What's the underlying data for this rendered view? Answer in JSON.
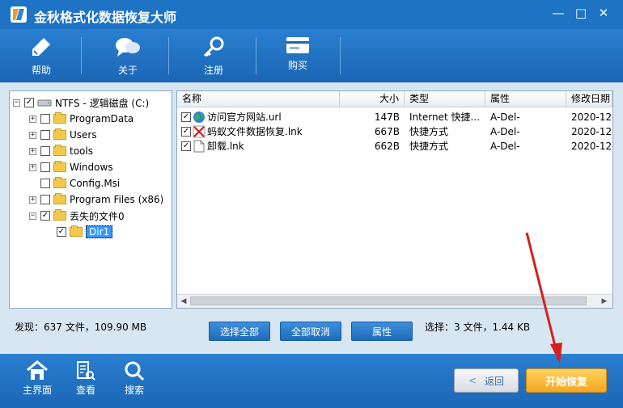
{
  "window": {
    "title": "金秋格式化数据恢复大师",
    "controls": {
      "minimize": "—",
      "maximize": "□",
      "close": "✕"
    }
  },
  "toolbar": [
    {
      "label": "帮助",
      "icon": "pen-icon"
    },
    {
      "label": "关于",
      "icon": "chat-bubble-icon"
    },
    {
      "label": "注册",
      "icon": "key-icon"
    },
    {
      "label": "购买",
      "icon": "card-icon"
    }
  ],
  "tree": {
    "root": {
      "label": "NTFS - 逻辑磁盘 (C:)",
      "checked": true,
      "expander": "−"
    },
    "items": [
      {
        "label": "ProgramData",
        "expander": "+",
        "checked": false
      },
      {
        "label": "Users",
        "expander": "+",
        "checked": false
      },
      {
        "label": "tools",
        "expander": "+",
        "checked": false
      },
      {
        "label": "Windows",
        "expander": "+",
        "checked": false
      },
      {
        "label": "Config.Msi",
        "expander": "",
        "checked": false
      },
      {
        "label": "Program Files (x86)",
        "expander": "+",
        "checked": false
      },
      {
        "label": "丢失的文件0",
        "expander": "−",
        "checked": true
      }
    ],
    "child": {
      "label": "Dir1",
      "checked": true
    }
  },
  "list": {
    "columns": [
      "名称",
      "大小",
      "类型",
      "属性",
      "修改日期"
    ],
    "rows": [
      {
        "name": "访问官方网站.url",
        "size": "147B",
        "type": "Internet 快捷...",
        "attr": "A-Del-",
        "date": "2020-12-",
        "icon": "globe-icon"
      },
      {
        "name": "蚂蚁文件数据恢复.lnk",
        "size": "667B",
        "type": "快捷方式",
        "attr": "A-Del-",
        "date": "2020-12-",
        "icon": "broken-link-icon"
      },
      {
        "name": "卸载.lnk",
        "size": "662B",
        "type": "快捷方式",
        "attr": "A-Del-",
        "date": "2020-12-",
        "icon": "file-icon"
      }
    ]
  },
  "status": {
    "found": "发现：637 文件，109.90 MB",
    "selected": "选择：3 文件，1.44 KB"
  },
  "buttons": {
    "select_all": "选择全部",
    "deselect_all": "全部取消",
    "properties": "属性"
  },
  "footer": {
    "home": "主界面",
    "view": "查看",
    "search": "搜索",
    "back": "返回",
    "restore": "开始恢复"
  },
  "colors": {
    "titlebar": "#1e73c4",
    "main_bg": "#d8e6f2",
    "accent_orange": "#f5a623",
    "annotation_arrow": "#d42020"
  }
}
